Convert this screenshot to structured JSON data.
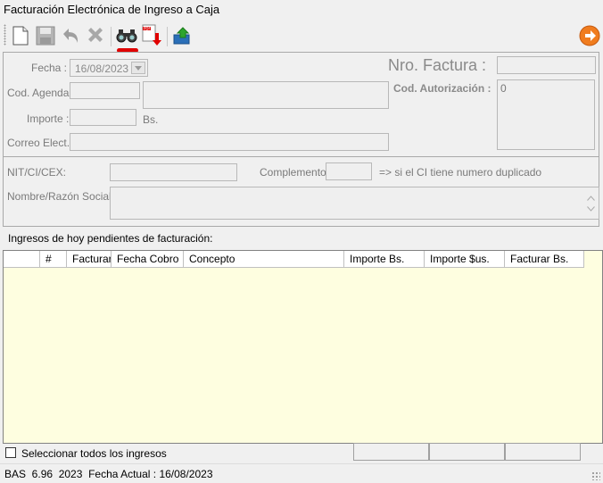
{
  "window": {
    "title": "Facturación Electrónica de Ingreso a Caja"
  },
  "toolbar": {
    "icons": [
      "new-document-icon",
      "save-icon",
      "undo-icon",
      "delete-icon",
      "search-binoculars-icon",
      "pdf-download-icon",
      "upload-export-icon",
      "next-arrow-icon"
    ]
  },
  "form": {
    "fecha_label": "Fecha :",
    "fecha_value": "16/08/2023",
    "cod_agenda_label": "Cod. Agenda:",
    "importe_label": "Importe :",
    "importe_unit": "Bs.",
    "correo_label": "Correo Elect.:",
    "nro_factura_label": "Nro. Factura :",
    "cod_autorizacion_label": "Cod. Autorización :",
    "cod_autorizacion_value": "0",
    "nit_label": "NIT/CI/CEX:",
    "complemento_label": "Complemento:",
    "complemento_hint": "=> si el CI tiene numero duplicado",
    "nombre_label": "Nombre/Razón Social :"
  },
  "grid": {
    "section_label": "Ingresos de hoy pendientes de facturación:",
    "columns": [
      "",
      "#",
      "Facturar",
      "Fecha Cobro",
      "Concepto",
      "Importe Bs.",
      "Importe $us.",
      "Facturar Bs."
    ],
    "rows": []
  },
  "footer": {
    "select_all_label": "Seleccionar todos los ingresos"
  },
  "status": {
    "text": "BAS  6.96  2023  Fecha Actual : 16/08/2023"
  },
  "colors": {
    "grid_bg": "#fefee0",
    "accent_red": "#e00000",
    "next_orange": "#f07c1e"
  }
}
